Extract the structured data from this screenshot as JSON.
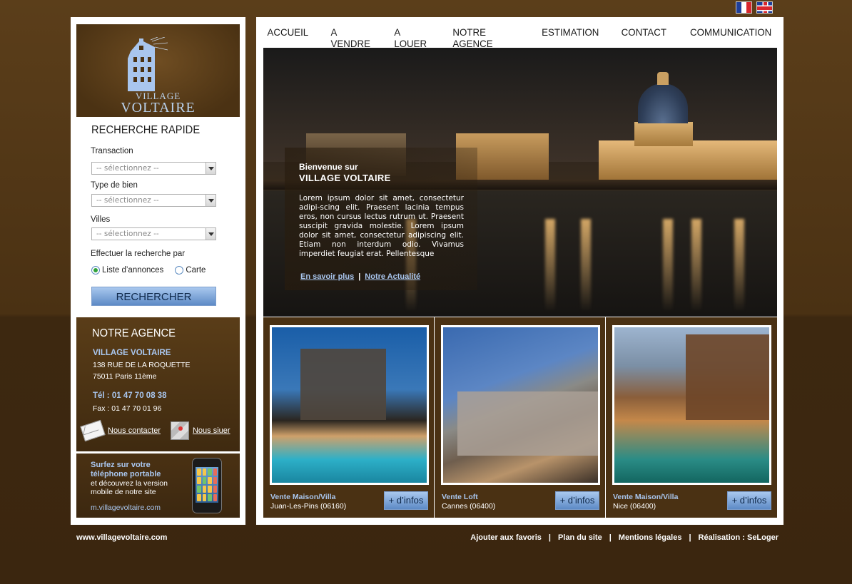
{
  "logo": {
    "line1": "VILLAGE",
    "line2": "VOLTAIRE"
  },
  "nav": [
    "ACCUEIL",
    "A VENDRE",
    "A LOUER",
    "NOTRE AGENCE",
    "ESTIMATION",
    "CONTACT",
    "COMMUNICATION"
  ],
  "search": {
    "title": "RECHERCHE RAPIDE",
    "transaction_label": "Transaction",
    "type_label": "Type de bien",
    "villes_label": "Villes",
    "placeholder": "-- sélectionnez --",
    "par_label": "Effectuer la recherche par",
    "option_list": "Liste d’annonces",
    "option_map": "Carte",
    "button": "RECHERCHER"
  },
  "agence": {
    "title": "NOTRE AGENCE",
    "name": "VILLAGE VOLTAIRE",
    "address1": "138 RUE DE LA ROQUETTE",
    "address2": "75011 Paris 11ème",
    "tel": "Tél : 01 47 70 08 38",
    "fax": "Fax : 01 47 70 01 96",
    "contact_link": "Nous contacter",
    "locate_link": "Nous siuer"
  },
  "mobile": {
    "line1": "Surfez sur votre",
    "line2": "téléphone portable",
    "line3": "et découvrez la version",
    "line4": "mobile de notre site",
    "url": "m.villagevoltaire.com"
  },
  "hero": {
    "welcome": "Bienvenue sur",
    "brand": "VILLAGE VOLTAIRE",
    "body": "Lorem ipsum dolor sit amet, consectetur adipi-scing elit. Praesent lacinia tempus eros, non cursus lectus rutrum ut. Praesent suscipit gravida molestie. Lorem ipsum dolor sit amet, consectetur adipiscing elit. Etiam non interdum odio. Vivamus imperdiet feugiat erat. Pellentesque",
    "link1": "En savoir plus",
    "link2": "Notre Actualité"
  },
  "cards": [
    {
      "type": "Vente Maison/Villa",
      "location": "Juan-Les-Pins (06160)",
      "button": "+ d’infos"
    },
    {
      "type": "Vente Loft",
      "location": "Cannes (06400)",
      "button": "+ d’infos"
    },
    {
      "type": "Vente Maison/Villa",
      "location": "Nice (06400)",
      "button": "+ d’infos"
    }
  ],
  "footer": {
    "site": "www.villagevoltaire.com",
    "links": [
      "Ajouter aux favoris",
      "Plan du site",
      "Mentions légales",
      "Réalisation : SeLoger"
    ],
    "separator": "|"
  },
  "colors": {
    "brown": "#4a3113",
    "accent_blue": "#a9c6ee",
    "button_blue": "#5d8ac6"
  }
}
